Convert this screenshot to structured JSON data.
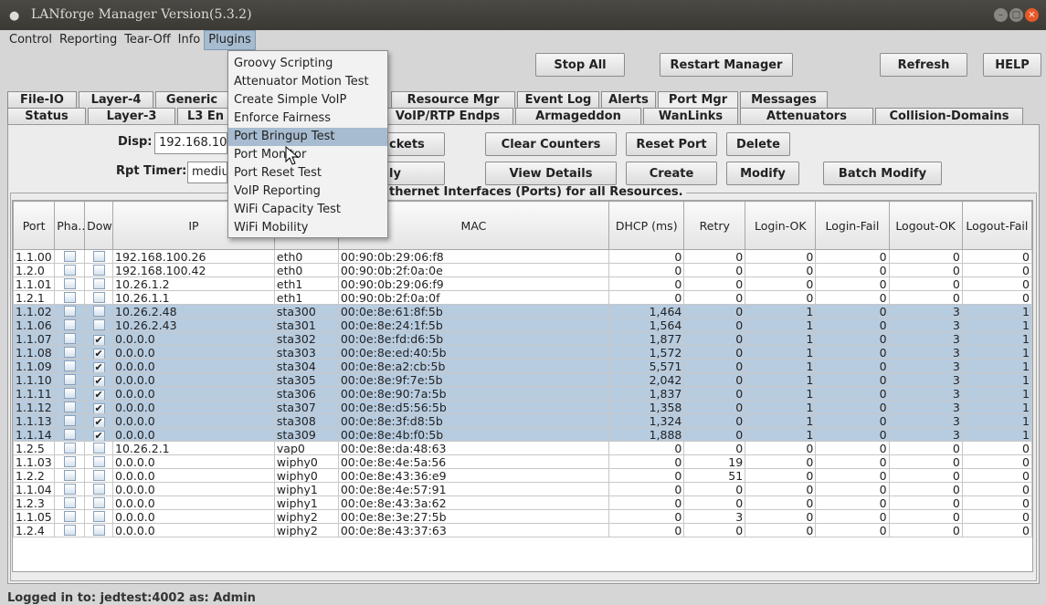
{
  "window": {
    "title": "LANforge Manager   Version(5.3.2)"
  },
  "menu": [
    "Control",
    "Reporting",
    "Tear-Off",
    "Info",
    "Plugins"
  ],
  "plugins_menu": [
    "Groovy Scripting",
    "Attenuator Motion Test",
    "Create Simple VoIP",
    "Enforce Fairness",
    "Port Bringup Test",
    "Port Monitor",
    "Port Reset Test",
    "VoIP Reporting",
    "WiFi Capacity Test",
    "WiFi Mobility"
  ],
  "plugins_menu_highlighted": "Port Bringup Test",
  "toolbar": {
    "stop_all": "Stop All",
    "restart_manager": "Restart Manager",
    "refresh": "Refresh",
    "help": "HELP"
  },
  "tabs_row1": [
    "File-IO",
    "Layer-4",
    "Generic",
    "Resource Mgr",
    "Event Log",
    "Alerts",
    "Port Mgr",
    "Messages"
  ],
  "tabs_row2": [
    "Status",
    "Layer-3",
    "L3 En",
    "VoIP/RTP Endps",
    "Armageddon",
    "WanLinks",
    "Attenuators",
    "Collision-Domains"
  ],
  "selected_tab": "Port Mgr",
  "controls": {
    "disp_label": "Disp:",
    "disp_value": "192.168.10",
    "rpt_timer_label": "Rpt Timer:",
    "rpt_timer_value": "mediu",
    "sniff_packets": "ckets",
    "apply": "ly",
    "clear_counters": "Clear Counters",
    "reset_port": "Reset Port",
    "delete": "Delete",
    "view_details": "View Details",
    "create": "Create",
    "modify": "Modify",
    "batch_modify": "Batch Modify"
  },
  "group_title": "thernet Interfaces (Ports) for all Resources.",
  "columns": [
    "Port",
    "Pha...",
    "Down",
    "IP",
    "",
    "MAC",
    "DHCP (ms)",
    "Retry",
    "Login-OK",
    "Login-Fail",
    "Logout-OK",
    "Logout-Fail"
  ],
  "rows": [
    {
      "port": "1.1.00",
      "down": false,
      "ip": "192.168.100.26",
      "dev": "eth0",
      "mac": "00:90:0b:29:06:f8",
      "dhcp": "0",
      "retry": "0",
      "login_ok": "0",
      "login_fail": "0",
      "logout_ok": "0",
      "logout_fail": "0",
      "selected": false
    },
    {
      "port": "1.2.0",
      "down": false,
      "ip": "192.168.100.42",
      "dev": "eth0",
      "mac": "00:90:0b:2f:0a:0e",
      "dhcp": "0",
      "retry": "0",
      "login_ok": "0",
      "login_fail": "0",
      "logout_ok": "0",
      "logout_fail": "0",
      "selected": false
    },
    {
      "port": "1.1.01",
      "down": false,
      "ip": "10.26.1.2",
      "dev": "eth1",
      "mac": "00:90:0b:29:06:f9",
      "dhcp": "0",
      "retry": "0",
      "login_ok": "0",
      "login_fail": "0",
      "logout_ok": "0",
      "logout_fail": "0",
      "selected": false
    },
    {
      "port": "1.2.1",
      "down": false,
      "ip": "10.26.1.1",
      "dev": "eth1",
      "mac": "00:90:0b:2f:0a:0f",
      "dhcp": "0",
      "retry": "0",
      "login_ok": "0",
      "login_fail": "0",
      "logout_ok": "0",
      "logout_fail": "0",
      "selected": false
    },
    {
      "port": "1.1.02",
      "down": false,
      "ip": "10.26.2.48",
      "dev": "sta300",
      "mac": "00:0e:8e:61:8f:5b",
      "dhcp": "1,464",
      "retry": "0",
      "login_ok": "1",
      "login_fail": "0",
      "logout_ok": "3",
      "logout_fail": "1",
      "selected": true
    },
    {
      "port": "1.1.06",
      "down": false,
      "ip": "10.26.2.43",
      "dev": "sta301",
      "mac": "00:0e:8e:24:1f:5b",
      "dhcp": "1,564",
      "retry": "0",
      "login_ok": "1",
      "login_fail": "0",
      "logout_ok": "3",
      "logout_fail": "1",
      "selected": true
    },
    {
      "port": "1.1.07",
      "down": true,
      "ip": "0.0.0.0",
      "dev": "sta302",
      "mac": "00:0e:8e:fd:d6:5b",
      "dhcp": "1,877",
      "retry": "0",
      "login_ok": "1",
      "login_fail": "0",
      "logout_ok": "3",
      "logout_fail": "1",
      "selected": true
    },
    {
      "port": "1.1.08",
      "down": true,
      "ip": "0.0.0.0",
      "dev": "sta303",
      "mac": "00:0e:8e:ed:40:5b",
      "dhcp": "1,572",
      "retry": "0",
      "login_ok": "1",
      "login_fail": "0",
      "logout_ok": "3",
      "logout_fail": "1",
      "selected": true
    },
    {
      "port": "1.1.09",
      "down": true,
      "ip": "0.0.0.0",
      "dev": "sta304",
      "mac": "00:0e:8e:a2:cb:5b",
      "dhcp": "5,571",
      "retry": "0",
      "login_ok": "1",
      "login_fail": "0",
      "logout_ok": "3",
      "logout_fail": "1",
      "selected": true
    },
    {
      "port": "1.1.10",
      "down": true,
      "ip": "0.0.0.0",
      "dev": "sta305",
      "mac": "00:0e:8e:9f:7e:5b",
      "dhcp": "2,042",
      "retry": "0",
      "login_ok": "1",
      "login_fail": "0",
      "logout_ok": "3",
      "logout_fail": "1",
      "selected": true
    },
    {
      "port": "1.1.11",
      "down": true,
      "ip": "0.0.0.0",
      "dev": "sta306",
      "mac": "00:0e:8e:90:7a:5b",
      "dhcp": "1,837",
      "retry": "0",
      "login_ok": "1",
      "login_fail": "0",
      "logout_ok": "3",
      "logout_fail": "1",
      "selected": true
    },
    {
      "port": "1.1.12",
      "down": true,
      "ip": "0.0.0.0",
      "dev": "sta307",
      "mac": "00:0e:8e:d5:56:5b",
      "dhcp": "1,358",
      "retry": "0",
      "login_ok": "1",
      "login_fail": "0",
      "logout_ok": "3",
      "logout_fail": "1",
      "selected": true
    },
    {
      "port": "1.1.13",
      "down": true,
      "ip": "0.0.0.0",
      "dev": "sta308",
      "mac": "00:0e:8e:3f:d8:5b",
      "dhcp": "1,324",
      "retry": "0",
      "login_ok": "1",
      "login_fail": "0",
      "logout_ok": "3",
      "logout_fail": "1",
      "selected": true
    },
    {
      "port": "1.1.14",
      "down": true,
      "ip": "0.0.0.0",
      "dev": "sta309",
      "mac": "00:0e:8e:4b:f0:5b",
      "dhcp": "1,888",
      "retry": "0",
      "login_ok": "1",
      "login_fail": "0",
      "logout_ok": "3",
      "logout_fail": "1",
      "selected": true
    },
    {
      "port": "1.2.5",
      "down": false,
      "ip": "10.26.2.1",
      "dev": "vap0",
      "mac": "00:0e:8e:da:48:63",
      "dhcp": "0",
      "retry": "0",
      "login_ok": "0",
      "login_fail": "0",
      "logout_ok": "0",
      "logout_fail": "0",
      "selected": false
    },
    {
      "port": "1.1.03",
      "down": false,
      "ip": "0.0.0.0",
      "dev": "wiphy0",
      "mac": "00:0e:8e:4e:5a:56",
      "dhcp": "0",
      "retry": "19",
      "login_ok": "0",
      "login_fail": "0",
      "logout_ok": "0",
      "logout_fail": "0",
      "selected": false
    },
    {
      "port": "1.2.2",
      "down": false,
      "ip": "0.0.0.0",
      "dev": "wiphy0",
      "mac": "00:0e:8e:43:36:e9",
      "dhcp": "0",
      "retry": "51",
      "login_ok": "0",
      "login_fail": "0",
      "logout_ok": "0",
      "logout_fail": "0",
      "selected": false
    },
    {
      "port": "1.1.04",
      "down": false,
      "ip": "0.0.0.0",
      "dev": "wiphy1",
      "mac": "00:0e:8e:4e:57:91",
      "dhcp": "0",
      "retry": "0",
      "login_ok": "0",
      "login_fail": "0",
      "logout_ok": "0",
      "logout_fail": "0",
      "selected": false
    },
    {
      "port": "1.2.3",
      "down": false,
      "ip": "0.0.0.0",
      "dev": "wiphy1",
      "mac": "00:0e:8e:43:3a:62",
      "dhcp": "0",
      "retry": "0",
      "login_ok": "0",
      "login_fail": "0",
      "logout_ok": "0",
      "logout_fail": "0",
      "selected": false
    },
    {
      "port": "1.1.05",
      "down": false,
      "ip": "0.0.0.0",
      "dev": "wiphy2",
      "mac": "00:0e:8e:3e:27:5b",
      "dhcp": "0",
      "retry": "3",
      "login_ok": "0",
      "login_fail": "0",
      "logout_ok": "0",
      "logout_fail": "0",
      "selected": false
    },
    {
      "port": "1.2.4",
      "down": false,
      "ip": "0.0.0.0",
      "dev": "wiphy2",
      "mac": "00:0e:8e:43:37:63",
      "dhcp": "0",
      "retry": "0",
      "login_ok": "0",
      "login_fail": "0",
      "logout_ok": "0",
      "logout_fail": "0",
      "selected": false
    }
  ],
  "status": "Logged in to:  jedtest:4002  as:  Admin",
  "colors": {
    "selection": "#b8cce0",
    "menu_highlight": "#a7bcd0",
    "titlebar": "#3c3b37",
    "close_button": "#e8592a"
  }
}
